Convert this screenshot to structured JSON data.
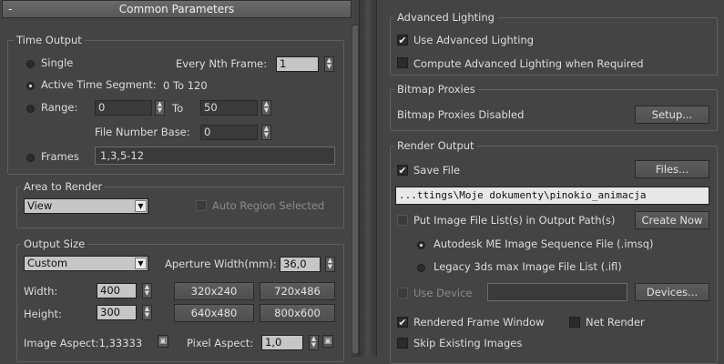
{
  "left": {
    "rollout_title": "Common Parameters",
    "rollout_toggle": "-",
    "time_output": {
      "legend": "Time Output",
      "single": "Single",
      "every_nth_label": "Every Nth Frame:",
      "every_nth_value": "1",
      "active_segment": "Active Time Segment:",
      "active_segment_range": "0 To 120",
      "range": "Range:",
      "range_from": "0",
      "range_to_label": "To",
      "range_to": "50",
      "file_number_base_label": "File Number Base:",
      "file_number_base": "0",
      "frames": "Frames",
      "frames_value": "1,3,5-12"
    },
    "area_to_render": {
      "legend": "Area to Render",
      "selected": "View",
      "auto_region": "Auto Region Selected"
    },
    "output_size": {
      "legend": "Output Size",
      "preset": "Custom",
      "aperture_label": "Aperture Width(mm):",
      "aperture_value": "36,0",
      "width_label": "Width:",
      "width_value": "400",
      "height_label": "Height:",
      "height_value": "300",
      "presets": [
        "320x240",
        "720x486",
        "640x480",
        "800x600"
      ],
      "image_aspect": "Image Aspect:1,33333",
      "pixel_aspect_label": "Pixel Aspect:",
      "pixel_aspect_value": "1,0"
    }
  },
  "right": {
    "advanced_lighting": {
      "legend": "Advanced Lighting",
      "use_advanced": "Use Advanced Lighting",
      "compute_when_required": "Compute Advanced Lighting when Required"
    },
    "bitmap_proxies": {
      "legend": "Bitmap Proxies",
      "status": "Bitmap Proxies Disabled",
      "setup_button": "Setup..."
    },
    "render_output": {
      "legend": "Render Output",
      "save_file": "Save File",
      "files_button": "Files...",
      "path": "...ttings\\Moje dokumenty\\pinokio_animacja",
      "put_image_file_list": "Put Image File List(s) in Output Path(s)",
      "create_now_button": "Create Now",
      "autodesk_sequence": "Autodesk ME Image Sequence File (.imsq)",
      "legacy_list": "Legacy 3ds max Image File List (.ifl)",
      "use_device": "Use Device",
      "devices_button": "Devices...",
      "rendered_frame_window": "Rendered Frame Window",
      "net_render": "Net Render",
      "skip_existing": "Skip Existing Images"
    }
  },
  "icons": {
    "checkmark": "✔",
    "dropdown_arrow": "▼",
    "spinner_up": "▲",
    "spinner_down": "▼",
    "lock": "🔒"
  }
}
